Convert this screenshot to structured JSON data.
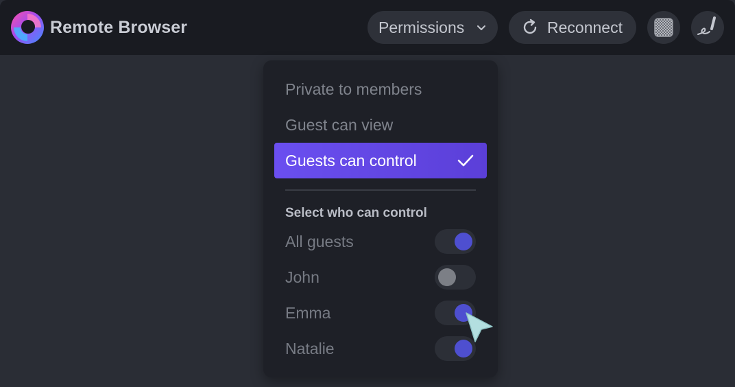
{
  "app": {
    "title": "Remote Browser"
  },
  "toolbar": {
    "permissions_label": "Permissions",
    "reconnect_label": "Reconnect",
    "icons": {
      "permissions": "chevron-down-icon",
      "reconnect": "refresh-icon",
      "pattern": "checkerboard-icon",
      "signature": "signature-icon"
    }
  },
  "permissions_menu": {
    "options": [
      {
        "label": "Private to members",
        "selected": false
      },
      {
        "label": "Guest can view",
        "selected": false
      },
      {
        "label": "Guests can control",
        "selected": true
      }
    ],
    "section_title": "Select who can control",
    "controls": [
      {
        "label": "All guests",
        "enabled": true
      },
      {
        "label": "John",
        "enabled": false
      },
      {
        "label": "Emma",
        "enabled": true
      },
      {
        "label": "Natalie",
        "enabled": true
      }
    ]
  },
  "colors": {
    "accent": "#6a4ff0",
    "toggle_on": "#4e4fd0",
    "toggle_off": "#7c7f86",
    "topbar": "#191b21",
    "background": "#2a2d35"
  }
}
